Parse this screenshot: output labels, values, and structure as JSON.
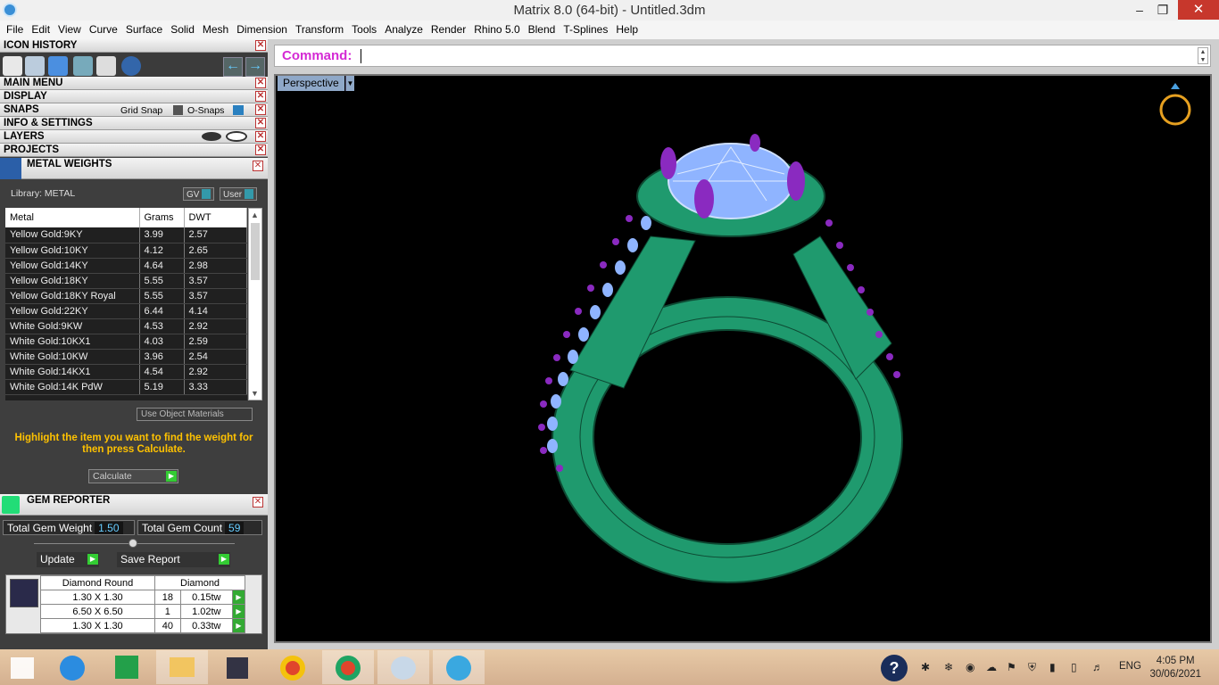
{
  "window": {
    "title": "Matrix 8.0 (64-bit) - Untitled.3dm",
    "minimize": "–",
    "restore": "❐",
    "close": "✕"
  },
  "menu": [
    "File",
    "Edit",
    "View",
    "Curve",
    "Surface",
    "Solid",
    "Mesh",
    "Dimension",
    "Transform",
    "Tools",
    "Analyze",
    "Render",
    "Rhino 5.0",
    "Blend",
    "T-Splines",
    "Help"
  ],
  "panels": {
    "icon_history": "ICON HISTORY",
    "main_menu": "MAIN MENU",
    "display": "DISPLAY",
    "snaps": "SNAPS",
    "grid_snap": "Grid Snap",
    "o_snaps": "O-Snaps",
    "info": "INFO & SETTINGS",
    "layers": "LAYERS",
    "projects": "PROJECTS",
    "close_glyph": "✕"
  },
  "metal_weights": {
    "title": "METAL WEIGHTS",
    "library": "Library: METAL",
    "gv": "GV",
    "user": "User",
    "columns": [
      "Metal",
      "Grams",
      "DWT"
    ],
    "rows": [
      [
        "Yellow Gold:9KY",
        "3.99",
        "2.57"
      ],
      [
        "Yellow Gold:10KY",
        "4.12",
        "2.65"
      ],
      [
        "Yellow Gold:14KY",
        "4.64",
        "2.98"
      ],
      [
        "Yellow Gold:18KY",
        "5.55",
        "3.57"
      ],
      [
        "Yellow Gold:18KY Royal",
        "5.55",
        "3.57"
      ],
      [
        "Yellow Gold:22KY",
        "6.44",
        "4.14"
      ],
      [
        "White Gold:9KW",
        "4.53",
        "2.92"
      ],
      [
        "White Gold:10KX1",
        "4.03",
        "2.59"
      ],
      [
        "White Gold:10KW",
        "3.96",
        "2.54"
      ],
      [
        "White Gold:14KX1",
        "4.54",
        "2.92"
      ],
      [
        "White Gold:14K PdW",
        "5.19",
        "3.33"
      ]
    ],
    "use_object_materials": "Use Object Materials",
    "hint": "Highlight the item you want to find the weight for then press Calculate.",
    "calculate": "Calculate"
  },
  "gem_reporter": {
    "title": "GEM REPORTER",
    "total_weight_label": "Total Gem Weight",
    "total_weight": "1.50",
    "total_count_label": "Total Gem Count",
    "total_count": "59",
    "update": "Update",
    "save_report": "Save Report",
    "header": [
      "Diamond Round",
      "Diamond"
    ],
    "rows": [
      [
        "1.30 X 1.30",
        "18",
        "0.15tw"
      ],
      [
        "6.50 X 6.50",
        "1",
        "1.02tw"
      ],
      [
        "1.30 X 1.30",
        "40",
        "0.33tw"
      ]
    ]
  },
  "command": {
    "label": "Command:"
  },
  "viewport": {
    "name": "Perspective"
  },
  "taskbar": {
    "lang": "ENG",
    "time": "4:05 PM",
    "date": "30/06/2021"
  },
  "colors": {
    "metal": "#1f9a6e",
    "gem": "#8fb4ff",
    "prong": "#8a2ac0",
    "command": "#d42ad4"
  }
}
